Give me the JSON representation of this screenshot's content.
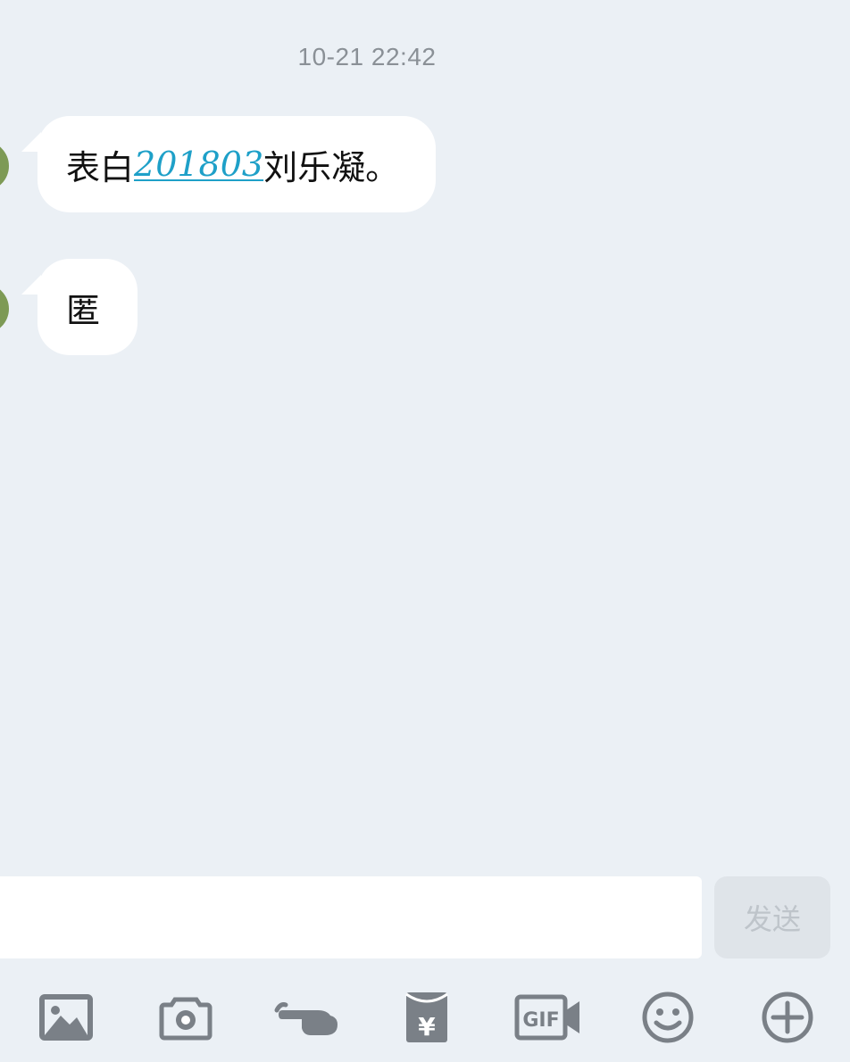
{
  "conversation": {
    "timestamp": "10-21 22:42",
    "messages": [
      {
        "parts": [
          {
            "text": "表白",
            "link": false
          },
          {
            "text": "201803",
            "link": true
          },
          {
            "text": "刘乐凝。",
            "link": false
          }
        ]
      },
      {
        "parts": [
          {
            "text": "匿",
            "link": false
          }
        ]
      }
    ]
  },
  "composer": {
    "input_value": "",
    "send_label": "发送"
  },
  "toolbar": {
    "icons": [
      "image-icon",
      "camera-icon",
      "poke-icon",
      "red-packet-icon",
      "gif-icon",
      "emoji-icon",
      "plus-icon"
    ],
    "red_packet_symbol": "¥",
    "gif_label": "GIF"
  },
  "colors": {
    "background": "#ebf0f5",
    "bubble": "#ffffff",
    "link": "#1ea0c8",
    "icon": "#7a8087",
    "timestamp": "#8a9096",
    "send_bg": "#dfe4e9",
    "send_text": "#bec4ca"
  }
}
